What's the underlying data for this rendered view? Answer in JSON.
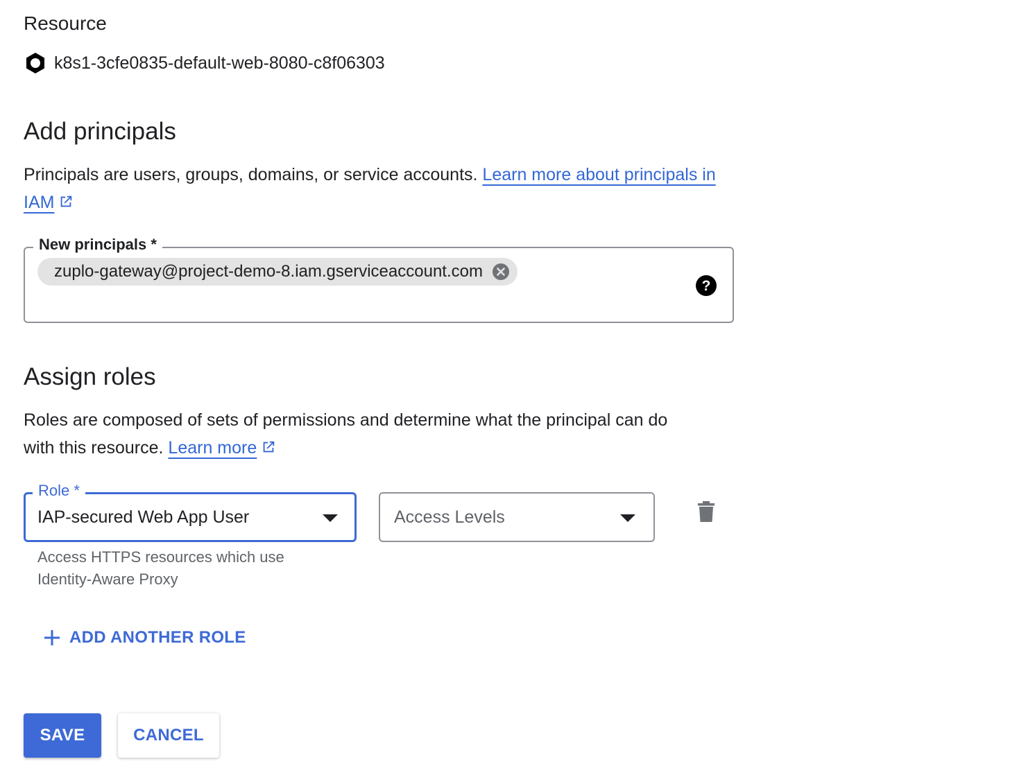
{
  "resource": {
    "label": "Resource",
    "name": "k8s1-3cfe0835-default-web-8080-c8f06303",
    "icon": "hexagon-resource-icon"
  },
  "add_principals": {
    "title": "Add principals",
    "description": "Principals are users, groups, domains, or service accounts.",
    "link_text": "Learn more about principals in IAM",
    "field_label": "New principals *",
    "chips": [
      {
        "value": "zuplo-gateway@project-demo-8.iam.gserviceaccount.com"
      }
    ]
  },
  "assign_roles": {
    "title": "Assign roles",
    "description_line1": "Roles are composed of sets of permissions and determine what the principal can do",
    "description_line2": "with this resource.",
    "link_text": "Learn more",
    "role_label": "Role *",
    "role_value": "IAP-secured Web App User",
    "role_help": "Access HTTPS resources which use Identity-Aware Proxy",
    "access_levels_placeholder": "Access Levels",
    "add_role_label": "ADD ANOTHER ROLE"
  },
  "actions": {
    "save_label": "SAVE",
    "cancel_label": "CANCEL"
  },
  "colors": {
    "accent": "#3d6ad6",
    "link": "#3367d6",
    "text": "#202124",
    "muted": "#5f6368",
    "chip_bg": "#e3e3e3"
  }
}
